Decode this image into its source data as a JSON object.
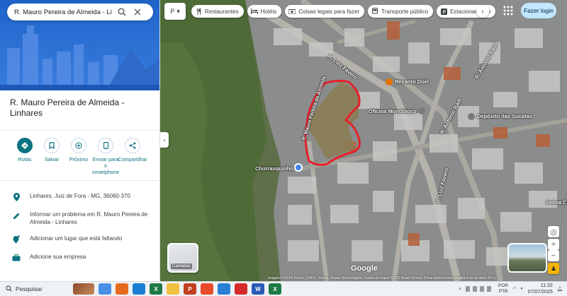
{
  "search": {
    "value": "R. Mauro Pereira de Almeida - Linha",
    "search_icon": "search-icon",
    "close_icon": "close-icon"
  },
  "place": {
    "title": "R. Mauro Pereira de Almeida - Linhares"
  },
  "actions": [
    {
      "label": "Rotas",
      "icon": "directions-icon"
    },
    {
      "label": "Salvar",
      "icon": "bookmark-icon"
    },
    {
      "label": "Próximo",
      "icon": "nearby-icon"
    },
    {
      "label": "Enviar para o smartphone",
      "icon": "phone-icon"
    },
    {
      "label": "Compartilhar",
      "icon": "share-icon"
    }
  ],
  "info": [
    {
      "text": "Linhares, Juiz de Fora - MG, 36060-370",
      "icon": "location-pin-icon"
    },
    {
      "text": "Informar um problema em R. Mauro Pereira de Almeida - Linhares",
      "icon": "pencil-icon"
    },
    {
      "text": "Adicionar um lugar que está faltando",
      "icon": "add-place-icon"
    },
    {
      "text": "Adicione sua empresa",
      "icon": "business-icon"
    }
  ],
  "chips": [
    {
      "label": "Restaurantes",
      "icon": "restaurant-icon"
    },
    {
      "label": "Hotéis",
      "icon": "hotel-icon"
    },
    {
      "label": "Coisas legais para fazer",
      "icon": "camera-icon"
    },
    {
      "label": "Transporte público",
      "icon": "bus-icon"
    },
    {
      "label": "Estacionamento",
      "icon": "parking-icon"
    }
  ],
  "layer_switch_label": "P",
  "login_label": "Fazer login",
  "layers_label": "Camadas",
  "map_labels": {
    "street_luiz_fávero_top": "R. Luiz Fávero",
    "street_luiz_fávero_bottom": "R. Luiz Fávero",
    "street_antonio_badi_top": "R. Antônio Badi",
    "street_antonio_badi_mid": "R. Antônio Badi",
    "street_mauro": "R. Mauro Pereira de Almeida",
    "poi_recanto": "Recanto Doel",
    "poi_oficina": "Oficina Monobloco",
    "poi_depositos": "Depósito das Sucatas",
    "poi_churrasquinho": "Churrasquinho",
    "poi_selma": "Selma Cl"
  },
  "google_logo": "Google",
  "attribution": "Imagens ©2025 Airbus, CNES / Airbus, Maxar Technologies, Dados do mapa ©2025   Brasil   Termos   Privacidade   Enviar feedback do produto   20 m",
  "taskbar": {
    "search_label": "Pesquisar",
    "lang_top": "POR",
    "lang_bottom": "PTB",
    "time": "11:32",
    "date": "07/07/2025"
  },
  "colors": {
    "accent": "#0b7380",
    "route_outline": "#e8202a",
    "hero_blue": "#1e64c8",
    "login_bg": "#c2e7ff"
  }
}
